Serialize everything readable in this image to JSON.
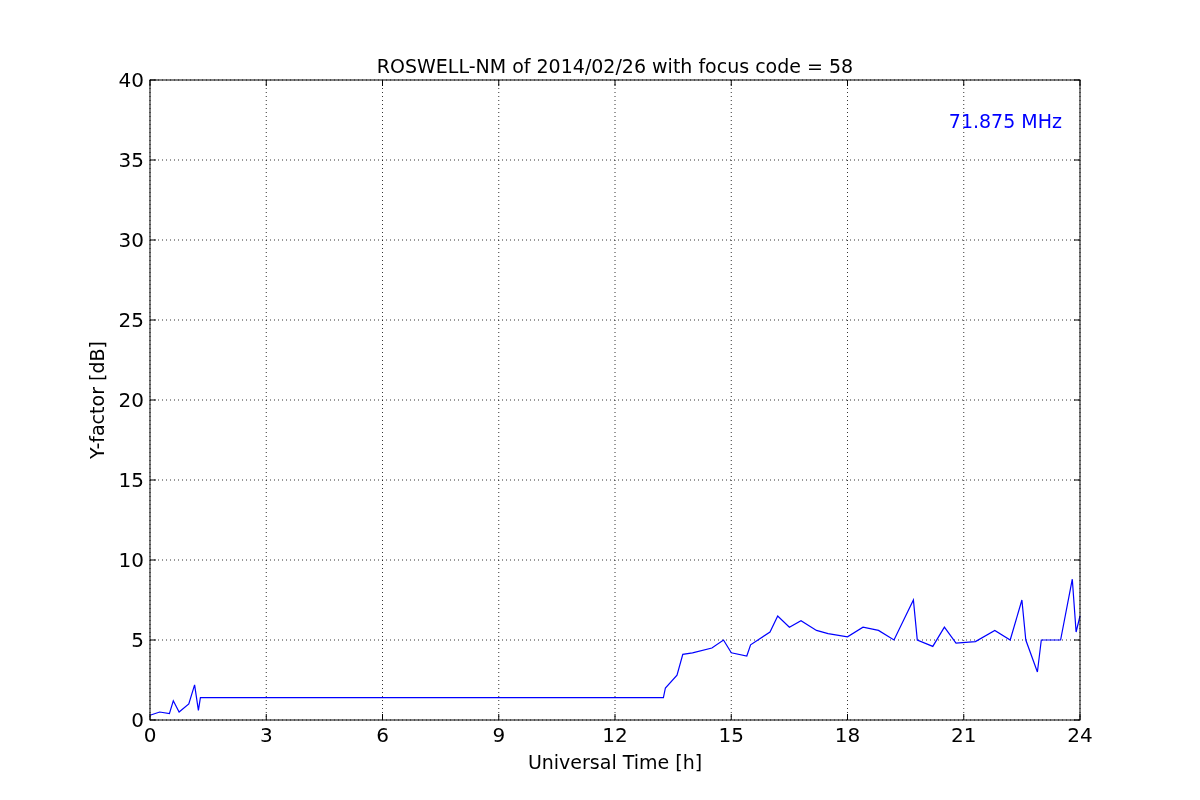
{
  "chart_data": {
    "type": "line",
    "title": "ROSWELL-NM of 2014/02/26 with focus code = 58",
    "xlabel": "Universal Time [h]",
    "ylabel": "Y-factor [dB]",
    "x": [
      0,
      0.25,
      0.5,
      0.6,
      0.75,
      1.0,
      1.15,
      1.25,
      1.3,
      13.25,
      13.3,
      13.6,
      13.75,
      14.0,
      14.5,
      14.8,
      15.0,
      15.4,
      15.5,
      16.0,
      16.2,
      16.5,
      16.8,
      17.2,
      17.5,
      18.0,
      18.4,
      18.8,
      19.2,
      19.7,
      19.8,
      20.2,
      20.5,
      20.8,
      21.3,
      21.8,
      22.2,
      22.5,
      22.6,
      22.9,
      23.0,
      23.5,
      23.8,
      23.9,
      24
    ],
    "series": [
      {
        "name": "71.875 MHz",
        "color": "#0000ff",
        "values": [
          0.3,
          0.5,
          0.4,
          1.2,
          0.5,
          1.0,
          2.2,
          0.6,
          1.4,
          1.4,
          2.0,
          2.8,
          4.1,
          4.2,
          4.5,
          5.0,
          4.2,
          4.0,
          4.7,
          5.5,
          6.5,
          5.8,
          6.2,
          5.6,
          5.4,
          5.2,
          5.8,
          5.6,
          5.0,
          7.5,
          5.0,
          4.6,
          5.8,
          4.8,
          4.9,
          5.6,
          5.0,
          7.5,
          5.0,
          3.0,
          5.0,
          5.0,
          8.8,
          5.5,
          6.5
        ]
      }
    ],
    "xlim": [
      0,
      24
    ],
    "ylim": [
      0,
      40
    ],
    "xticks": [
      0,
      3,
      6,
      9,
      12,
      15,
      18,
      21,
      24
    ],
    "yticks": [
      0,
      5,
      10,
      15,
      20,
      25,
      30,
      35,
      40
    ],
    "grid": true
  }
}
